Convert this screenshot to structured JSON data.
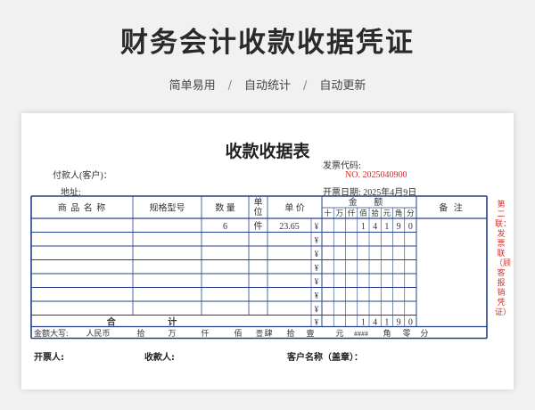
{
  "header": {
    "title": "财务会计收款收据凭证",
    "features": [
      "简单易用",
      "自动统计",
      "自动更新"
    ],
    "separator": "/"
  },
  "receipt": {
    "title": "收款收据表",
    "payer_label": "付款人(客户)：",
    "address_label": "地址:",
    "invoice_code_label": "发票代码:",
    "invoice_no_label": "NO.",
    "invoice_no": "2025040900",
    "invoice_date_label": "开票日期:",
    "invoice_date": "2025年4月9日",
    "columns": {
      "product": "商 品 名 称",
      "spec": "规格型号",
      "qty": "数 量",
      "unit": "单位",
      "price": "单 价",
      "amount": "金 额",
      "notes": "备 注"
    },
    "digit_headers": [
      "十",
      "万",
      "仟",
      "佰",
      "拾",
      "元",
      "角",
      "分"
    ],
    "rows": [
      {
        "product": "",
        "spec": "",
        "qty": "6",
        "unit": "件",
        "price": "23.65",
        "currency": "¥",
        "digits": [
          "",
          "",
          "",
          "1",
          "4",
          "1",
          "9",
          "0"
        ]
      },
      {
        "product": "",
        "spec": "",
        "qty": "",
        "unit": "",
        "price": "",
        "currency": "¥",
        "digits": [
          "",
          "",
          "",
          "",
          "",
          "",
          "",
          ""
        ]
      },
      {
        "product": "",
        "spec": "",
        "qty": "",
        "unit": "",
        "price": "",
        "currency": "¥",
        "digits": [
          "",
          "",
          "",
          "",
          "",
          "",
          "",
          ""
        ]
      },
      {
        "product": "",
        "spec": "",
        "qty": "",
        "unit": "",
        "price": "",
        "currency": "¥",
        "digits": [
          "",
          "",
          "",
          "",
          "",
          "",
          "",
          ""
        ]
      },
      {
        "product": "",
        "spec": "",
        "qty": "",
        "unit": "",
        "price": "",
        "currency": "¥",
        "digits": [
          "",
          "",
          "",
          "",
          "",
          "",
          "",
          ""
        ]
      },
      {
        "product": "",
        "spec": "",
        "qty": "",
        "unit": "",
        "price": "",
        "currency": "¥",
        "digits": [
          "",
          "",
          "",
          "",
          "",
          "",
          "",
          ""
        ]
      },
      {
        "product": "",
        "spec": "",
        "qty": "",
        "unit": "",
        "price": "",
        "currency": "¥",
        "digits": [
          "",
          "",
          "",
          "",
          "",
          "",
          "",
          ""
        ]
      }
    ],
    "total": {
      "label": "合 计",
      "currency": "¥",
      "digits": [
        "",
        "",
        "",
        "1",
        "4",
        "1",
        "9",
        "0"
      ]
    },
    "capital_row": {
      "label": "金额大写:",
      "currency": "人民币",
      "units": [
        "拾",
        "万",
        "仟",
        "佰",
        "肆",
        "拾",
        "壹",
        "元",
        "角",
        "零",
        "分"
      ],
      "digit_values": [
        "",
        "",
        "",
        "壹",
        "",
        "",
        "",
        "####",
        "",
        "",
        ""
      ]
    },
    "side_note": "第二联：发票联（顾客报销凭证）",
    "footer": {
      "issuer_label": "开票人:",
      "payee_label": "收款人:",
      "customer_label": "客户名称（盖章）："
    }
  }
}
